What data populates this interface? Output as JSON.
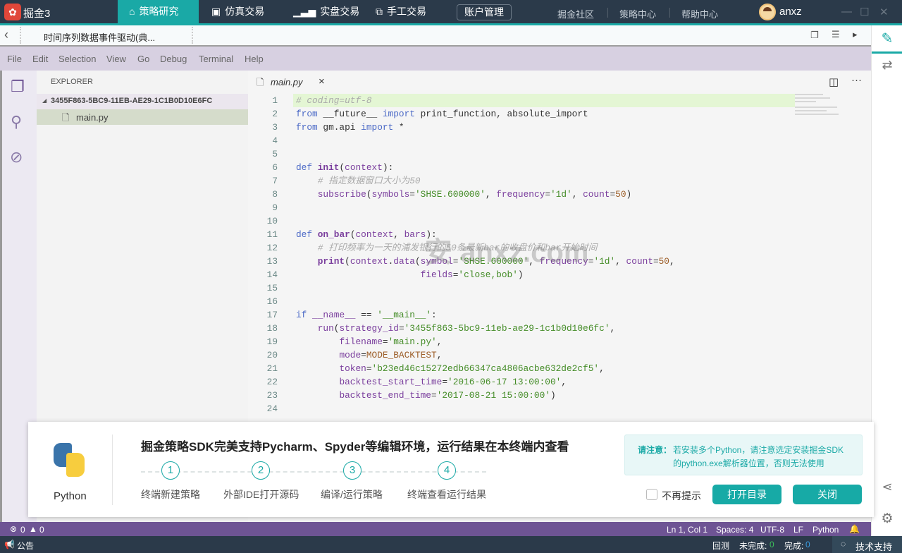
{
  "app": {
    "logo": "掘",
    "title": "掘金3"
  },
  "nav": {
    "tabs": [
      {
        "label": "策略研究",
        "icon": "graduation-cap-icon",
        "active": true
      },
      {
        "label": "仿真交易",
        "icon": "chart-monitor-icon"
      },
      {
        "label": "实盘交易",
        "icon": "bar-chart-icon"
      },
      {
        "label": "手工交易",
        "icon": "manual-trade-icon"
      }
    ],
    "account": "账户管理",
    "links": [
      "掘金社区",
      "策略中心",
      "帮助中心"
    ],
    "user": "anxz"
  },
  "tabbar": {
    "title": "时间序列数据事件驱动(典..."
  },
  "menu": [
    "File",
    "Edit",
    "Selection",
    "View",
    "Go",
    "Debug",
    "Terminal",
    "Help"
  ],
  "explorer": {
    "header": "EXPLORER",
    "folder": "3455F863-5BC9-11EB-AE29-1C1B0D10E6FC",
    "file": "main.py"
  },
  "editor": {
    "tab": "main.py",
    "close": "×",
    "lines": [
      [
        [
          "c",
          "# coding=utf-8"
        ]
      ],
      [
        [
          "k",
          "from"
        ],
        [
          "t",
          " __future__ "
        ],
        [
          "k",
          "import"
        ],
        [
          "t",
          " print_function, absolute_import"
        ]
      ],
      [
        [
          "k",
          "from"
        ],
        [
          "t",
          " gm.api "
        ],
        [
          "k",
          "import"
        ],
        [
          "t",
          " *"
        ]
      ],
      [],
      [],
      [
        [
          "k",
          "def"
        ],
        [
          "t",
          " "
        ],
        [
          "f",
          "init"
        ],
        [
          "t",
          "("
        ],
        [
          "v",
          "context"
        ],
        [
          "t",
          "):"
        ]
      ],
      [
        [
          "t",
          "    "
        ],
        [
          "c",
          "# 指定数据窗口大小为50"
        ]
      ],
      [
        [
          "t",
          "    "
        ],
        [
          "v",
          "subscribe"
        ],
        [
          "t",
          "("
        ],
        [
          "v",
          "symbols"
        ],
        [
          "t",
          "="
        ],
        [
          "s",
          "'SHSE.600000'"
        ],
        [
          "t",
          ", "
        ],
        [
          "v",
          "frequency"
        ],
        [
          "t",
          "="
        ],
        [
          "s",
          "'1d'"
        ],
        [
          "t",
          ", "
        ],
        [
          "v",
          "count"
        ],
        [
          "t",
          "="
        ],
        [
          "n",
          "50"
        ],
        [
          "t",
          ")"
        ]
      ],
      [],
      [],
      [
        [
          "k",
          "def"
        ],
        [
          "t",
          " "
        ],
        [
          "f",
          "on_bar"
        ],
        [
          "t",
          "("
        ],
        [
          "v",
          "context"
        ],
        [
          "t",
          ", "
        ],
        [
          "v",
          "bars"
        ],
        [
          "t",
          "):"
        ]
      ],
      [
        [
          "t",
          "    "
        ],
        [
          "c",
          "# 打印频率为一天的浦发银行的50条最新bar的收盘价和bar开始时间"
        ]
      ],
      [
        [
          "t",
          "    "
        ],
        [
          "f",
          "print"
        ],
        [
          "t",
          "("
        ],
        [
          "v",
          "context"
        ],
        [
          "t",
          "."
        ],
        [
          "v",
          "data"
        ],
        [
          "t",
          "("
        ],
        [
          "v",
          "symbol"
        ],
        [
          "t",
          "="
        ],
        [
          "s",
          "'SHSE.600000'"
        ],
        [
          "t",
          ", "
        ],
        [
          "v",
          "frequency"
        ],
        [
          "t",
          "="
        ],
        [
          "s",
          "'1d'"
        ],
        [
          "t",
          ", "
        ],
        [
          "v",
          "count"
        ],
        [
          "t",
          "="
        ],
        [
          "n",
          "50"
        ],
        [
          "t",
          ","
        ]
      ],
      [
        [
          "t",
          "                       "
        ],
        [
          "v",
          "fields"
        ],
        [
          "t",
          "="
        ],
        [
          "s",
          "'close,bob'"
        ],
        [
          "t",
          ")"
        ]
      ],
      [],
      [],
      [
        [
          "k",
          "if"
        ],
        [
          "t",
          " "
        ],
        [
          "v",
          "__name__"
        ],
        [
          "t",
          " == "
        ],
        [
          "s",
          "'__main__'"
        ],
        [
          "t",
          ":"
        ]
      ],
      [
        [
          "t",
          "    "
        ],
        [
          "v",
          "run"
        ],
        [
          "t",
          "("
        ],
        [
          "v",
          "strategy_id"
        ],
        [
          "t",
          "="
        ],
        [
          "s",
          "'3455f863-5bc9-11eb-ae29-1c1b0d10e6fc'"
        ],
        [
          "t",
          ","
        ]
      ],
      [
        [
          "t",
          "        "
        ],
        [
          "v",
          "filename"
        ],
        [
          "t",
          "="
        ],
        [
          "s",
          "'main.py'"
        ],
        [
          "t",
          ","
        ]
      ],
      [
        [
          "t",
          "        "
        ],
        [
          "v",
          "mode"
        ],
        [
          "t",
          "="
        ],
        [
          "n",
          "MODE_BACKTEST"
        ],
        [
          "t",
          ","
        ]
      ],
      [
        [
          "t",
          "        "
        ],
        [
          "v",
          "token"
        ],
        [
          "t",
          "="
        ],
        [
          "s",
          "'b23ed46c15272edb66347ca4806acbe632de2cf5'"
        ],
        [
          "t",
          ","
        ]
      ],
      [
        [
          "t",
          "        "
        ],
        [
          "v",
          "backtest_start_time"
        ],
        [
          "t",
          "="
        ],
        [
          "s",
          "'2016-06-17 13:00:00'"
        ],
        [
          "t",
          ","
        ]
      ],
      [
        [
          "t",
          "        "
        ],
        [
          "v",
          "backtest_end_time"
        ],
        [
          "t",
          "="
        ],
        [
          "s",
          "'2017-08-21 15:00:00'"
        ],
        [
          "t",
          ")"
        ]
      ],
      []
    ]
  },
  "dialog": {
    "logo_label": "Python",
    "title": "掘金策略SDK完美支持Pycharm、Spyder等编辑环境，运行结果在本终端内查看",
    "steps": [
      {
        "n": "1",
        "label": "终端新建策略"
      },
      {
        "n": "2",
        "label": "外部IDE打开源码"
      },
      {
        "n": "3",
        "label": "编译/运行策略"
      },
      {
        "n": "4",
        "label": "终端查看运行结果"
      }
    ],
    "notice_label": "请注意：",
    "notice_line1": "若安装多个Python，请注意选定安装掘金SDK",
    "notice_line2": "的python.exe解析器位置，否则无法使用",
    "checkbox": "不再提示",
    "checked": false,
    "open_dir": "打开目录",
    "close": "关闭"
  },
  "status": {
    "errors": "0",
    "warnings": "0",
    "position": "Ln 1, Col 1",
    "spaces": "Spaces: 4",
    "encoding": "UTF-8",
    "eol": "LF",
    "language": "Python"
  },
  "bottom": {
    "announce": "公告",
    "backtest": "回测",
    "pending_label": "未完成:",
    "pending": "0",
    "done_label": "完成:",
    "done": "0",
    "support": "技术支持"
  },
  "colors": {
    "accent": "#1aa9a6",
    "topbar": "#2b3a4a",
    "status": "#6e5494",
    "menubar": "#d7d0e1"
  }
}
